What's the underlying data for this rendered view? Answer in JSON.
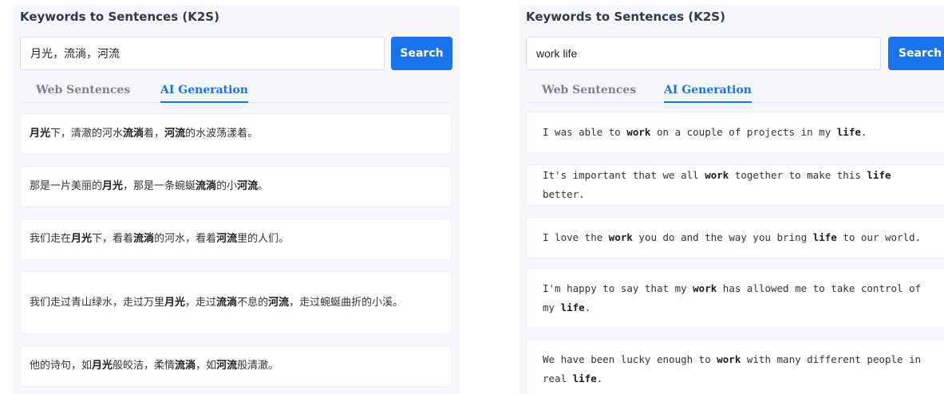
{
  "left_panel": {
    "title": "Keywords to Sentences (K2S)",
    "search_value": "月光，流淌，河流",
    "search_button": "Search",
    "tabs": [
      "Web Sentences",
      "AI Generation"
    ],
    "active_tab": "AI Generation",
    "sentences": [
      [
        {
          "t": "月光",
          "b": true
        },
        {
          "t": "下，清澈的河水",
          "b": false
        },
        {
          "t": "流淌",
          "b": true
        },
        {
          "t": "着，",
          "b": false
        },
        {
          "t": "河流",
          "b": true
        },
        {
          "t": "的水波荡漾着。",
          "b": false
        }
      ],
      [
        {
          "t": "那是一片美丽的",
          "b": false
        },
        {
          "t": "月光",
          "b": true
        },
        {
          "t": "，那是一条蜿蜒",
          "b": false
        },
        {
          "t": "流淌",
          "b": true
        },
        {
          "t": "的小",
          "b": false
        },
        {
          "t": "河流",
          "b": true
        },
        {
          "t": "。",
          "b": false
        }
      ],
      [
        {
          "t": "我们走在",
          "b": false
        },
        {
          "t": "月光",
          "b": true
        },
        {
          "t": "下，看着",
          "b": false
        },
        {
          "t": "流淌",
          "b": true
        },
        {
          "t": "的河水，看着",
          "b": false
        },
        {
          "t": "河流",
          "b": true
        },
        {
          "t": "里的人们。",
          "b": false
        }
      ],
      [
        {
          "t": "我们走过青山绿水，走过万里",
          "b": false
        },
        {
          "t": "月光",
          "b": true
        },
        {
          "t": "，走过",
          "b": false
        },
        {
          "t": "流淌",
          "b": true
        },
        {
          "t": "不息的",
          "b": false
        },
        {
          "t": "河流",
          "b": true
        },
        {
          "t": "，走过蜿蜒曲折的小溪。",
          "b": false
        }
      ],
      [
        {
          "t": "他的诗句，如",
          "b": false
        },
        {
          "t": "月光",
          "b": true
        },
        {
          "t": "般皎洁，柔情",
          "b": false
        },
        {
          "t": "流淌",
          "b": true
        },
        {
          "t": "，如",
          "b": false
        },
        {
          "t": "河流",
          "b": true
        },
        {
          "t": "般清澈。",
          "b": false
        }
      ]
    ]
  },
  "right_panel": {
    "title": "Keywords to Sentences (K2S)",
    "search_value": "work life",
    "search_button": "Search",
    "tabs": [
      "Web Sentences",
      "AI Generation"
    ],
    "active_tab": "AI Generation",
    "sentences": [
      [
        {
          "t": "I was able to ",
          "b": false
        },
        {
          "t": "work",
          "b": true
        },
        {
          "t": " on a couple of projects in my ",
          "b": false
        },
        {
          "t": "life",
          "b": true
        },
        {
          "t": ".",
          "b": false
        }
      ],
      [
        {
          "t": "It's important that we all ",
          "b": false
        },
        {
          "t": "work",
          "b": true
        },
        {
          "t": " together to make this ",
          "b": false
        },
        {
          "t": "life",
          "b": true
        },
        {
          "t": " better.",
          "b": false
        }
      ],
      [
        {
          "t": "I love the ",
          "b": false
        },
        {
          "t": "work",
          "b": true
        },
        {
          "t": " you do and the way you bring ",
          "b": false
        },
        {
          "t": "life",
          "b": true
        },
        {
          "t": " to our world.",
          "b": false
        }
      ],
      [
        {
          "t": "I'm happy to say that my ",
          "b": false
        },
        {
          "t": "work",
          "b": true
        },
        {
          "t": " has allowed me to take control of my ",
          "b": false
        },
        {
          "t": "life",
          "b": true
        },
        {
          "t": ".",
          "b": false
        }
      ],
      [
        {
          "t": "We have been lucky enough to ",
          "b": false
        },
        {
          "t": "work",
          "b": true
        },
        {
          "t": " with many different people in real ",
          "b": false
        },
        {
          "t": "life",
          "b": true
        },
        {
          "t": ".",
          "b": false
        }
      ]
    ]
  },
  "colors": {
    "accent": "#1a73e8",
    "panel_bg": "#f6f7fb",
    "card_bg": "#ffffff",
    "title_text": "#2e3a4b"
  }
}
